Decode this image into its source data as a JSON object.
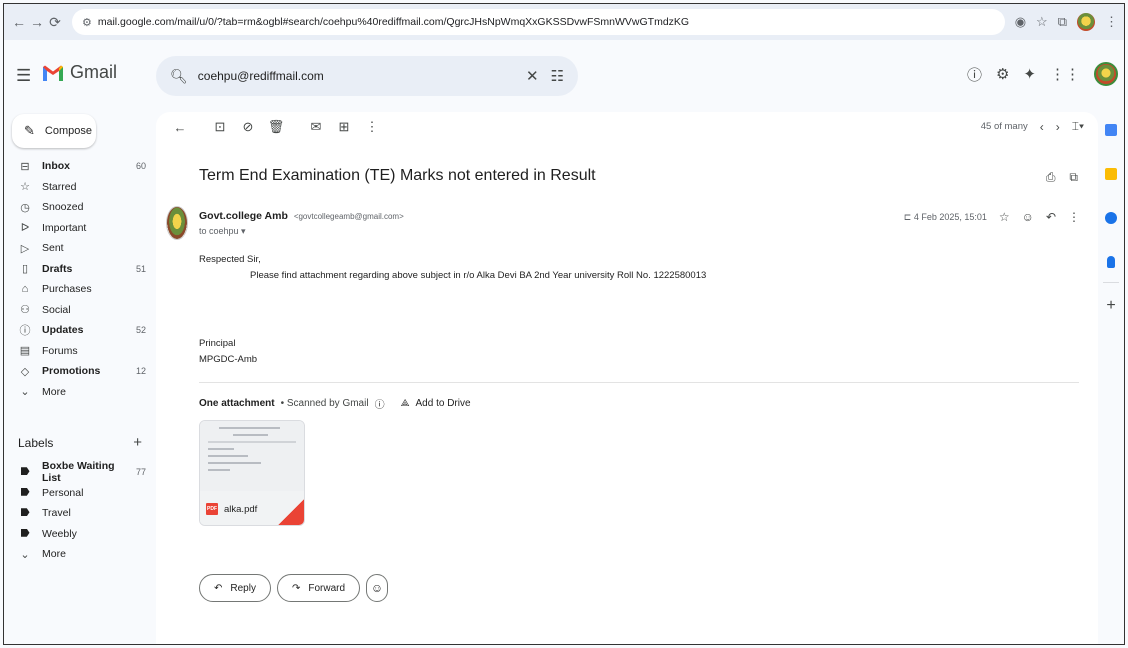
{
  "browser": {
    "url": "mail.google.com/mail/u/0/?tab=rm&ogbl#search/coehpu%40rediffmail.com/QgrcJHsNpWmqXxGKSSDvwFSmnWVwGTmdzKG"
  },
  "app": {
    "name": "Gmail"
  },
  "search": {
    "value": "coehpu@rediffmail.com"
  },
  "compose_label": "Compose",
  "nav": [
    {
      "label": "Inbox",
      "count": "60",
      "bold": true,
      "icon": "inbox-icon"
    },
    {
      "label": "Starred",
      "count": "",
      "bold": false,
      "icon": "star-icon"
    },
    {
      "label": "Snoozed",
      "count": "",
      "bold": false,
      "icon": "clock-icon"
    },
    {
      "label": "Important",
      "count": "",
      "bold": false,
      "icon": "important-icon"
    },
    {
      "label": "Sent",
      "count": "",
      "bold": false,
      "icon": "send-icon"
    },
    {
      "label": "Drafts",
      "count": "51",
      "bold": true,
      "icon": "draft-icon"
    },
    {
      "label": "Purchases",
      "count": "",
      "bold": false,
      "icon": "bag-icon"
    },
    {
      "label": "Social",
      "count": "",
      "bold": false,
      "icon": "people-icon"
    },
    {
      "label": "Updates",
      "count": "52",
      "bold": true,
      "icon": "info-icon"
    },
    {
      "label": "Forums",
      "count": "",
      "bold": false,
      "icon": "forum-icon"
    },
    {
      "label": "Promotions",
      "count": "12",
      "bold": true,
      "icon": "tag-icon"
    },
    {
      "label": "More",
      "count": "",
      "bold": false,
      "icon": "chevron-down-icon"
    }
  ],
  "labels_heading": "Labels",
  "labels": [
    {
      "label": "Boxbe Waiting List",
      "count": "77",
      "bold": true
    },
    {
      "label": "Personal",
      "count": "",
      "bold": false
    },
    {
      "label": "Travel",
      "count": "",
      "bold": false
    },
    {
      "label": "Weebly",
      "count": "",
      "bold": false
    }
  ],
  "labels_more": "More",
  "toolbar": {
    "position": "45 of many"
  },
  "email": {
    "subject": "Term End Examination (TE) Marks not entered in Result",
    "sender_name": "Govt.college Amb",
    "sender_email": "<govtcollegeamb@gmail.com>",
    "to": "to coehpu ▾",
    "date": "4 Feb 2025, 15:01",
    "greeting": "Respected Sir,",
    "body": "Please find attachment regarding above subject in r/o Alka Devi BA 2nd Year university Roll No. 1222580013",
    "sign1": "Principal",
    "sign2": "MPGDC-Amb"
  },
  "attachments": {
    "heading": "One attachment",
    "scanned": "• Scanned by Gmail",
    "drive": "Add to Drive",
    "file_name": "alka.pdf",
    "file_type": "PDF"
  },
  "actions": {
    "reply": "Reply",
    "forward": "Forward"
  },
  "colors": {
    "accent": "#0b57d0",
    "gmail_red": "#ea4335",
    "surface": "#f8fafd"
  }
}
